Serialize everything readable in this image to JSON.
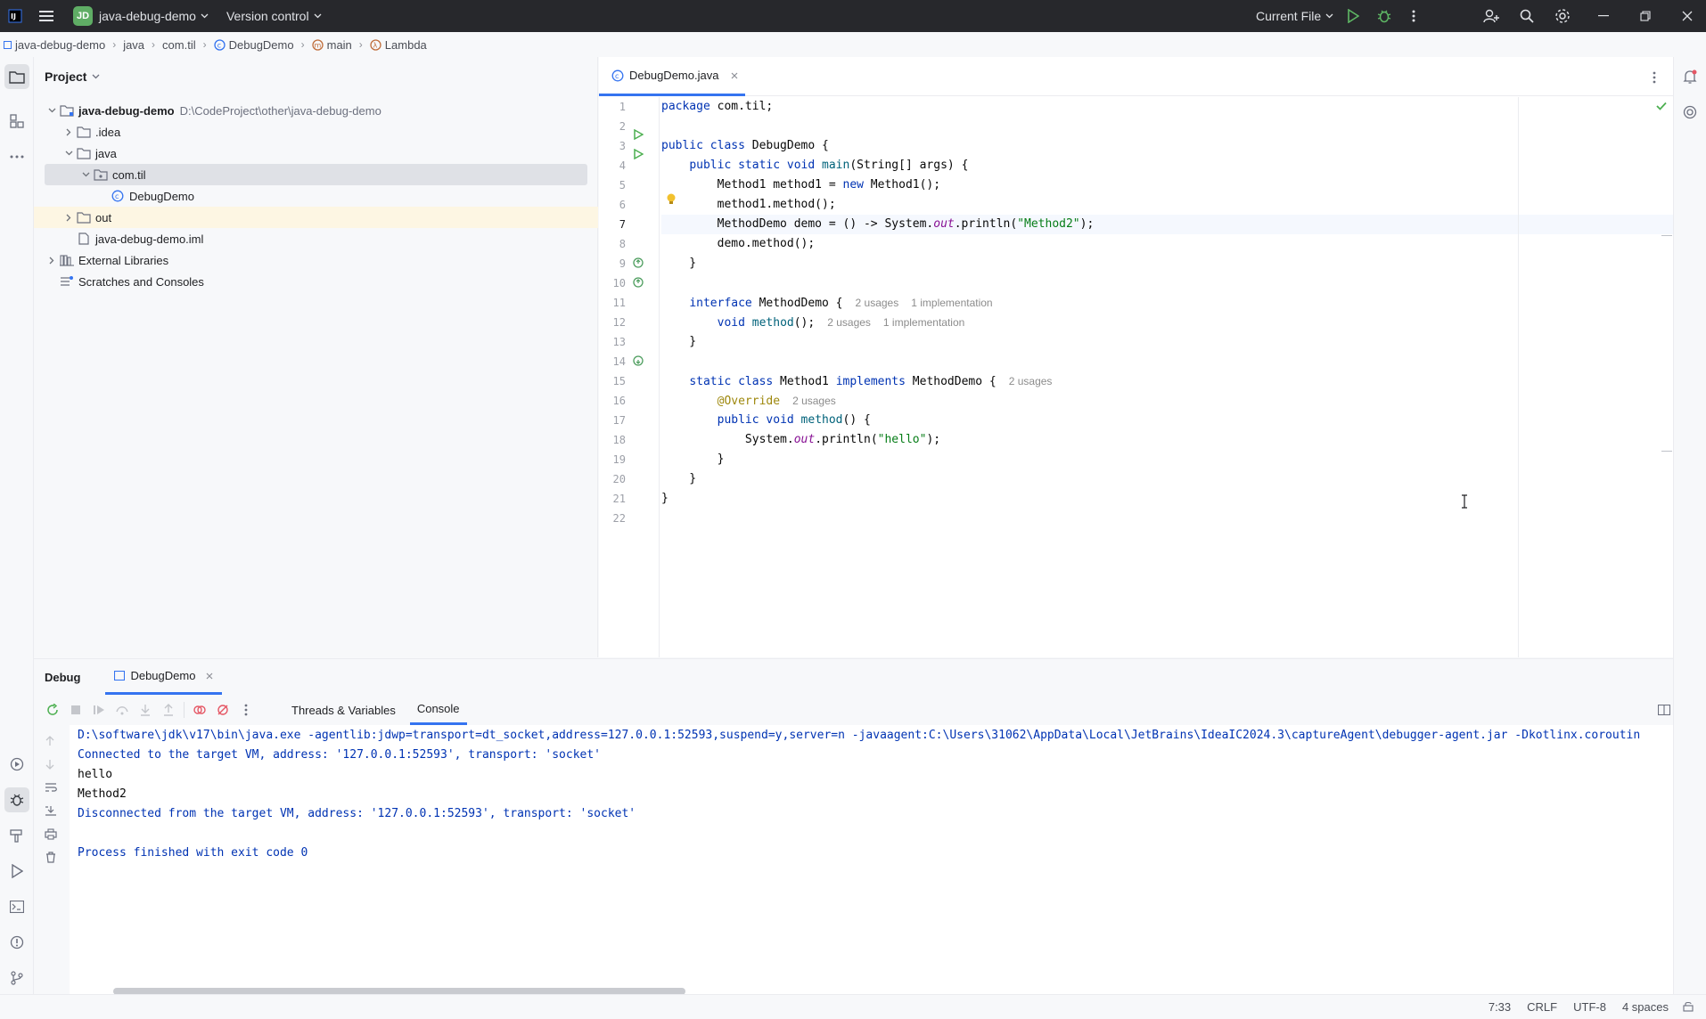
{
  "titlebar": {
    "project_badge": "JD",
    "project_name": "java-debug-demo",
    "vcs": "Version control",
    "run_config": "Current File"
  },
  "breadcrumb": [
    "java-debug-demo",
    "java",
    "com.til",
    "DebugDemo",
    "main",
    "Lambda"
  ],
  "project": {
    "title": "Project",
    "tree": [
      {
        "label": "java-debug-demo",
        "path": "D:\\CodeProject\\other\\java-debug-demo",
        "depth": 0,
        "icon": "module-folder-icon",
        "expanded": true,
        "bold": true
      },
      {
        "label": ".idea",
        "depth": 1,
        "icon": "folder-icon",
        "expanded": false
      },
      {
        "label": "java",
        "depth": 1,
        "icon": "folder-icon",
        "expanded": true
      },
      {
        "label": "com.til",
        "depth": 2,
        "icon": "package-icon",
        "expanded": true,
        "selected": true
      },
      {
        "label": "DebugDemo",
        "depth": 3,
        "icon": "java-class-icon"
      },
      {
        "label": "out",
        "depth": 1,
        "icon": "folder-icon",
        "expanded": false,
        "highlight": true
      },
      {
        "label": "java-debug-demo.iml",
        "depth": 1,
        "icon": "iml-file-icon"
      },
      {
        "label": "External Libraries",
        "depth": 0,
        "icon": "library-icon",
        "expanded": false
      },
      {
        "label": "Scratches and Consoles",
        "depth": 0,
        "icon": "scratches-icon"
      }
    ]
  },
  "editor": {
    "tab": "DebugDemo.java",
    "line_numbers": [
      "1",
      "2",
      "3",
      "4",
      "5",
      "6",
      "7",
      "8",
      "9",
      "10",
      "11",
      "12",
      "13",
      "14",
      "15",
      "16",
      "17",
      "18",
      "19",
      "20",
      "21",
      "22"
    ],
    "current_line": 7,
    "hints": {
      "l11_usages": "2 usages",
      "l11_impl": "1 implementation",
      "l12_usages": "2 usages",
      "l12_impl": "1 implementation",
      "l15_usages": "2 usages",
      "l16_usages": "2 usages"
    }
  },
  "debug": {
    "title": "Debug",
    "session": "DebugDemo",
    "tabs": [
      "Threads & Variables",
      "Console"
    ],
    "active_tab": "Console",
    "console": [
      {
        "text": "D:\\software\\jdk\\v17\\bin\\java.exe -agentlib:jdwp=transport=dt_socket,address=127.0.0.1:52593,suspend=y,server=n -javaagent:C:\\Users\\31062\\AppData\\Local\\JetBrains\\IdeaIC2024.3\\captureAgent\\debugger-agent.jar -Dkotlinx.coroutin",
        "kind": "sys"
      },
      {
        "text": "Connected to the target VM, address: '127.0.0.1:52593', transport: 'socket'",
        "kind": "sys"
      },
      {
        "text": "hello",
        "kind": "out"
      },
      {
        "text": "Method2",
        "kind": "out"
      },
      {
        "text": "Disconnected from the target VM, address: '127.0.0.1:52593', transport: 'socket'",
        "kind": "sys"
      },
      {
        "text": "",
        "kind": "out"
      },
      {
        "text": "Process finished with exit code 0",
        "kind": "sys"
      }
    ]
  },
  "statusbar": {
    "position": "7:33",
    "line_sep": "CRLF",
    "encoding": "UTF-8",
    "indent": "4 spaces"
  },
  "colors": {
    "accent": "#3574f0",
    "keyword": "#0033b3",
    "string": "#067d17",
    "run_green": "#4caf50"
  }
}
